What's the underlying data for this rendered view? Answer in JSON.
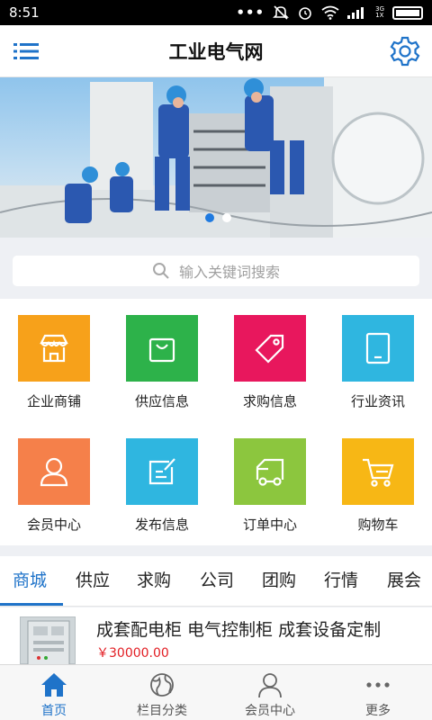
{
  "status_bar": {
    "time": "8:51",
    "signal_top": "3G",
    "signal_bottom": "1X"
  },
  "header": {
    "title": "工业电气网",
    "menu_icon": "menu-icon",
    "settings_icon": "gear-icon"
  },
  "banner": {
    "pages": 2,
    "active_page": 1
  },
  "search": {
    "placeholder": "输入关键词搜索"
  },
  "grid": [
    {
      "label": "企业商铺",
      "icon": "store-icon",
      "color": "#f7a11a"
    },
    {
      "label": "供应信息",
      "icon": "shopping-bag-icon",
      "color": "#2db24a"
    },
    {
      "label": "求购信息",
      "icon": "tag-icon",
      "color": "#e8175d"
    },
    {
      "label": "行业资讯",
      "icon": "tablet-icon",
      "color": "#2fb6e0"
    },
    {
      "label": "会员中心",
      "icon": "user-icon",
      "color": "#f5804a"
    },
    {
      "label": "发布信息",
      "icon": "edit-icon",
      "color": "#2fb6e0"
    },
    {
      "label": "订单中心",
      "icon": "truck-icon",
      "color": "#8cc63e"
    },
    {
      "label": "购物车",
      "icon": "cart-icon",
      "color": "#f7b715"
    }
  ],
  "tabs": [
    {
      "label": "商城",
      "active": true
    },
    {
      "label": "供应"
    },
    {
      "label": "求购"
    },
    {
      "label": "公司"
    },
    {
      "label": "团购"
    },
    {
      "label": "行情"
    },
    {
      "label": "展会"
    }
  ],
  "product": {
    "title": "成套配电柜 电气控制柜 成套设备定制",
    "price": "￥30000.00"
  },
  "bottom_nav": [
    {
      "label": "首页",
      "icon": "home-icon",
      "active": true
    },
    {
      "label": "栏目分类",
      "icon": "globe-icon"
    },
    {
      "label": "会员中心",
      "icon": "user-icon"
    },
    {
      "label": "更多",
      "icon": "more-icon"
    }
  ],
  "colors": {
    "accent": "#1f73c9",
    "price": "#e21d23"
  }
}
